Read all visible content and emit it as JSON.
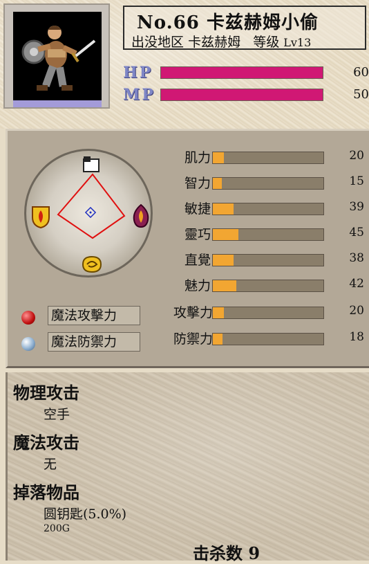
{
  "header": {
    "number_label": "No.66",
    "name": "卡兹赫姆小偷",
    "location_label": "出没地区",
    "location": "卡兹赫姆",
    "level_label": "等级",
    "level": "Lv13"
  },
  "vitals": [
    {
      "label": "HP",
      "value": "60",
      "fill": 1.0
    },
    {
      "label": "MP",
      "value": "50",
      "fill": 1.0
    }
  ],
  "stats": [
    {
      "label": "肌力",
      "value": "20",
      "fill": 0.1
    },
    {
      "label": "智力",
      "value": "15",
      "fill": 0.08
    },
    {
      "label": "敏捷",
      "value": "39",
      "fill": 0.19
    },
    {
      "label": "靈巧",
      "value": "45",
      "fill": 0.23
    },
    {
      "label": "直覺",
      "value": "38",
      "fill": 0.19
    },
    {
      "label": "魅力",
      "value": "42",
      "fill": 0.21
    },
    {
      "label": "攻擊力",
      "value": "20",
      "fill": 0.1
    },
    {
      "label": "防禦力",
      "value": "18",
      "fill": 0.09
    }
  ],
  "magic": {
    "attack_label": "魔法攻擊力",
    "defense_label": "魔法防禦力"
  },
  "icons": {
    "top": "gauntlet-icon",
    "left": "fire-shield-icon",
    "right": "flame-emblem-icon",
    "bottom": "wind-emblem-icon",
    "attack_orb": "red-orb-icon",
    "defense_orb": "blue-orb-icon"
  },
  "colors": {
    "hp_mp_bar": "#d01874",
    "stat_bar": "#f2a632",
    "stat_track": "#8a7e6a"
  },
  "info": {
    "phys_attack_label": "物理攻击",
    "phys_attack_value": "空手",
    "magic_attack_label": "魔法攻击",
    "magic_attack_value": "无",
    "drops_label": "掉落物品",
    "drop_item": "圆钥匙(5.0%)",
    "gold": "200G",
    "kills_label": "击杀数",
    "kills_value": "9"
  }
}
